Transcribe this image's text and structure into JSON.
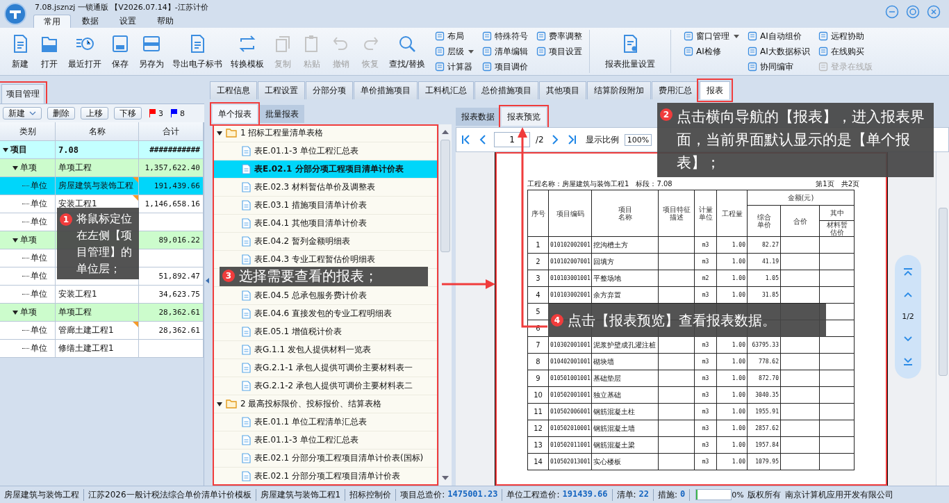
{
  "window": {
    "title": "7.08.jsznzj 一锁通版 【V2026.07.14】-江苏计价"
  },
  "menu_tabs": [
    {
      "label": "常用",
      "selected": true
    },
    {
      "label": "数据",
      "selected": false
    },
    {
      "label": "设置",
      "selected": false
    },
    {
      "label": "帮助",
      "selected": false
    }
  ],
  "toolbar": {
    "large_buttons": [
      {
        "label": "新建",
        "disabled": false
      },
      {
        "label": "打开",
        "disabled": false
      },
      {
        "label": "最近打开",
        "disabled": false
      },
      {
        "label": "保存",
        "disabled": false
      },
      {
        "label": "另存为",
        "disabled": false
      },
      {
        "label": "导出电子标书",
        "disabled": false
      },
      {
        "label": "转换模板",
        "disabled": false
      },
      {
        "label": "复制",
        "disabled": true
      },
      {
        "label": "粘贴",
        "disabled": true
      },
      {
        "label": "撤销",
        "disabled": true
      },
      {
        "label": "恢复",
        "disabled": true
      },
      {
        "label": "查找/替换",
        "disabled": false
      }
    ],
    "small_groups": [
      [
        {
          "label": "布局",
          "dropdown": false
        },
        {
          "label": "层级",
          "dropdown": true
        },
        {
          "label": "计算器",
          "dropdown": false
        }
      ],
      [
        {
          "label": "特殊符号",
          "dropdown": false
        },
        {
          "label": "清单编辑",
          "dropdown": false
        },
        {
          "label": "项目调价",
          "dropdown": false
        }
      ],
      [
        {
          "label": "费率调整",
          "dropdown": false
        },
        {
          "label": "项目设置",
          "dropdown": false
        }
      ]
    ],
    "batch_button": "报表批量设置",
    "right_groups": [
      [
        {
          "label": "窗口管理",
          "dropdown": true,
          "disabled": false
        },
        {
          "label": "AI检修",
          "dropdown": false,
          "disabled": false
        }
      ],
      [
        {
          "label": "AI自动组价",
          "dropdown": false,
          "disabled": false
        },
        {
          "label": "AI大数据标识",
          "dropdown": false,
          "disabled": false
        },
        {
          "label": "协同编审",
          "dropdown": false,
          "disabled": false
        }
      ],
      [
        {
          "label": "远程协助",
          "dropdown": false,
          "disabled": false
        },
        {
          "label": "在线购买",
          "dropdown": false,
          "disabled": false
        },
        {
          "label": "登录在线版",
          "dropdown": false,
          "disabled": true
        }
      ]
    ]
  },
  "project_panel": {
    "tab": "项目管理",
    "buttons": [
      {
        "label": "新建",
        "dropdown": true
      },
      {
        "label": "删除",
        "dropdown": false
      },
      {
        "label": "上移",
        "dropdown": false
      },
      {
        "label": "下移",
        "dropdown": false
      }
    ],
    "flags": [
      {
        "color": "#ff0000",
        "count": "3"
      },
      {
        "color": "#0000ff",
        "count": "8"
      }
    ],
    "columns": [
      "类别",
      "名称",
      "合计"
    ],
    "tree": [
      {
        "kind": "project",
        "category": "项目",
        "name": "7.08",
        "total": "###########",
        "expanded": true,
        "selected": false,
        "marked": false,
        "children": [
          {
            "kind": "item",
            "category": "单项",
            "name": "单项工程",
            "total": "1,357,622.40",
            "expanded": true,
            "selected": false,
            "marked": false,
            "children": [
              {
                "kind": "unit",
                "category": "单位",
                "name": "房屋建筑与装饰工程",
                "total": "191,439.66",
                "selected": true,
                "marked": true
              },
              {
                "kind": "unit",
                "category": "单位",
                "name": "安装工程1",
                "total": "1,146,658.16",
                "selected": false,
                "marked": true
              },
              {
                "kind": "unit",
                "category": "单位",
                "selected": false,
                "marked": false
              }
            ]
          },
          {
            "kind": "item",
            "category": "单项",
            "total": "89,016.22",
            "expanded": true,
            "selected": false,
            "marked": false,
            "children": [
              {
                "kind": "unit",
                "category": "单位",
                "selected": false,
                "marked": false
              },
              {
                "kind": "unit",
                "category": "单位",
                "total": "51,892.47",
                "selected": false,
                "marked": false
              },
              {
                "kind": "unit",
                "category": "单位",
                "name": "安装工程1",
                "total": "34,623.75",
                "selected": false,
                "marked": false
              }
            ]
          },
          {
            "kind": "item",
            "category": "单项",
            "name": "单项工程",
            "total": "28,362.61",
            "expanded": true,
            "selected": false,
            "marked": false,
            "children": [
              {
                "kind": "unit",
                "category": "单位",
                "name": "管廊土建工程1",
                "total": "28,362.61",
                "selected": false,
                "marked": true
              },
              {
                "kind": "unit",
                "category": "单位",
                "name": "修缮土建工程1",
                "selected": false,
                "marked": false
              }
            ]
          }
        ]
      }
    ]
  },
  "main_tabs": [
    {
      "label": "工程信息",
      "selected": false
    },
    {
      "label": "工程设置",
      "selected": false
    },
    {
      "label": "分部分项",
      "selected": false
    },
    {
      "label": "单价措施项目",
      "selected": false
    },
    {
      "label": "工料机汇总",
      "selected": false
    },
    {
      "label": "总价措施项目",
      "selected": false
    },
    {
      "label": "其他项目",
      "selected": false
    },
    {
      "label": "结算阶段附加",
      "selected": false
    },
    {
      "label": "费用汇总",
      "selected": false
    },
    {
      "label": "报表",
      "selected": true
    }
  ],
  "sub_tabs": [
    {
      "label": "单个报表",
      "selected": true
    },
    {
      "label": "批量报表",
      "selected": false
    }
  ],
  "report_tree": [
    {
      "kind": "folder",
      "label": "1  招标工程量清单表格",
      "expanded": true,
      "selected": false,
      "children": [
        {
          "kind": "report",
          "label": "表E.01.1-3  单位工程汇总表",
          "selected": false
        },
        {
          "kind": "report",
          "label": "表E.02.1  分部分项工程项目清单计价表",
          "selected": true
        },
        {
          "kind": "report",
          "label": "表E.02.3  材料暂估单价及调整表",
          "selected": false
        },
        {
          "kind": "report",
          "label": "表E.03.1  措施项目清单计价表",
          "selected": false
        },
        {
          "kind": "report",
          "label": "表E.04.1  其他项目清单计价表",
          "selected": false
        },
        {
          "kind": "report",
          "label": "表E.04.2  暂列金额明细表",
          "selected": false
        },
        {
          "kind": "report",
          "label": "表E.04.3  专业工程暂估价明细表",
          "selected": false
        },
        {
          "kind": "covered",
          "selected": false
        },
        {
          "kind": "report",
          "label": "表E.04.5  总承包服务费计价表",
          "selected": false
        },
        {
          "kind": "report",
          "label": "表E.04.6  直接发包的专业工程明细表",
          "selected": false
        },
        {
          "kind": "report",
          "label": "表E.05.1  增值税计价表",
          "selected": false
        },
        {
          "kind": "report",
          "label": "表G.1.1  发包人提供材料一览表",
          "selected": false
        },
        {
          "kind": "report",
          "label": "表G.2.1-1  承包人提供可调价主要材料表一",
          "selected": false
        },
        {
          "kind": "report",
          "label": "表G.2.1-2  承包人提供可调价主要材料表二",
          "selected": false
        }
      ]
    },
    {
      "kind": "folder",
      "label": "2  最高投标限价、投标报价、结算表格",
      "expanded": true,
      "selected": false,
      "children": [
        {
          "kind": "report",
          "label": "表E.01.1  单位工程清单汇总表",
          "selected": false
        },
        {
          "kind": "report",
          "label": "表E.01.1-3  单位工程汇总表",
          "selected": false
        },
        {
          "kind": "report",
          "label": "表E.02.1  分部分项工程项目清单计价表(国标)",
          "selected": false
        },
        {
          "kind": "report",
          "label": "表E.02.1  分部分项工程项目清单计价表",
          "selected": false
        }
      ]
    }
  ],
  "preview_tabs": [
    {
      "label": "报表数据",
      "selected": false
    },
    {
      "label": "报表预览",
      "selected": true
    }
  ],
  "pager": {
    "page": "1",
    "total": "/2",
    "zoom_label": "显示比例",
    "zoom": "100%"
  },
  "report": {
    "info_left": [
      "工程名称：房屋建筑与装饰工程1",
      "标段：7.08"
    ],
    "info_right": [
      "第1页",
      "共2页"
    ],
    "columns": [
      "序号",
      "项目编码",
      "项目名称",
      "项目特征描述",
      "计量单位",
      "工程量"
    ],
    "amount_header": "金额(元)",
    "amount_columns": [
      "综合单价",
      "合价"
    ],
    "sub_header": "其中",
    "sub_column": "材料暂估价",
    "rows": [
      {
        "no": "1",
        "code": "010102002001",
        "name": "挖沟槽土方",
        "unit": "m3",
        "qty": "1.00",
        "price": "82.27"
      },
      {
        "no": "2",
        "code": "010102007001",
        "name": "回填方",
        "unit": "m3",
        "qty": "1.00",
        "price": "41.19"
      },
      {
        "no": "3",
        "code": "010103001001",
        "name": "平整场地",
        "unit": "m2",
        "qty": "1.00",
        "price": "1.05"
      },
      {
        "no": "4",
        "code": "010103002001",
        "name": "余方弃置",
        "unit": "m3",
        "qty": "1.00",
        "price": "31.85"
      },
      {
        "no": "5"
      },
      {
        "no": "6"
      },
      {
        "no": "7",
        "code": "010302001001",
        "name": "泥浆护壁成孔灌注桩",
        "unit": "m3",
        "qty": "1.00",
        "price": "63795.33"
      },
      {
        "no": "8",
        "code": "010402001001",
        "name": "砌块墙",
        "unit": "m3",
        "qty": "1.00",
        "price": "778.62"
      },
      {
        "no": "9",
        "code": "010501001001",
        "name": "基础垫层",
        "unit": "m3",
        "qty": "1.00",
        "price": "872.70"
      },
      {
        "no": "10",
        "code": "010502001001",
        "name": "独立基础",
        "unit": "m3",
        "qty": "1.00",
        "price": "3040.35"
      },
      {
        "no": "11",
        "code": "010502006001",
        "name": "钢筋混凝土柱",
        "unit": "m3",
        "qty": "1.00",
        "price": "1955.91"
      },
      {
        "no": "12",
        "code": "010502010001",
        "name": "钢筋混凝土墙",
        "unit": "m3",
        "qty": "1.00",
        "price": "2857.62"
      },
      {
        "no": "13",
        "code": "010502011001",
        "name": "钢筋混凝土梁",
        "unit": "m3",
        "qty": "1.00",
        "price": "1957.84"
      },
      {
        "no": "14",
        "code": "010502013001",
        "name": "实心楼板",
        "unit": "m3",
        "qty": "1.00",
        "price": "1079.95"
      }
    ]
  },
  "float_pager": {
    "page": "1/2"
  },
  "callouts": [
    {
      "number": "1",
      "text": "将鼠标定位在左侧【项目管理】的单位层；"
    },
    {
      "number": "2",
      "text": "点击横向导航的【报表】，进入报表界面，当前界面默认显示的是【单个报表】；"
    },
    {
      "number": "3",
      "text": "选择需要查看的报表；"
    },
    {
      "number": "4",
      "text": "点击【报表预览】查看报表数据。"
    }
  ],
  "status_bar": {
    "items": [
      {
        "kind": "text",
        "text": "房屋建筑与装饰工程"
      },
      {
        "kind": "text",
        "text": "江苏2026一般计税法综合单价清单计价模板"
      },
      {
        "kind": "text",
        "text": "房屋建筑与装饰工程1"
      },
      {
        "kind": "text",
        "text": "招标控制价"
      },
      {
        "kind": "pair",
        "label": "项目总造价:",
        "value": "1475001.23"
      },
      {
        "kind": "pair",
        "label": "单位工程造价:",
        "value": "191439.66"
      },
      {
        "kind": "pair",
        "label": "清单:",
        "value": "22"
      },
      {
        "kind": "pair",
        "label": "措施:",
        "value": "0"
      }
    ],
    "progress": {
      "level": 0,
      "text": "0%"
    },
    "copyright": "版权所有",
    "company": "南京计算机应用开发有限公司"
  }
}
